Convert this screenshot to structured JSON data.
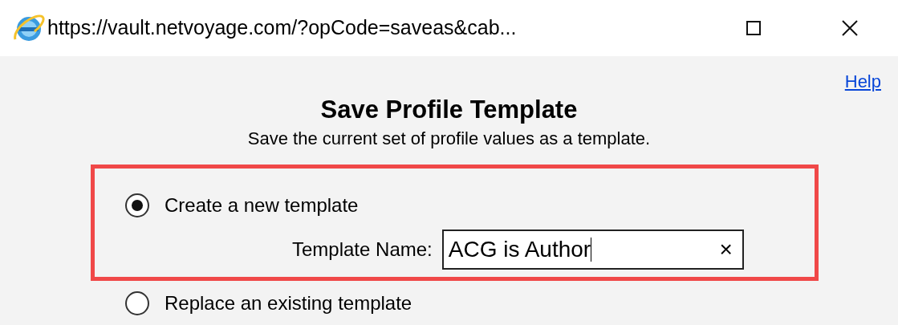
{
  "window": {
    "title": "https://vault.netvoyage.com/?opCode=saveas&cab..."
  },
  "help_link": "Help",
  "heading": "Save Profile Template",
  "subtitle": "Save the current set of profile values as a template.",
  "highlight": {
    "color": "#f04848"
  },
  "options": [
    {
      "label": "Create a new template",
      "selected": true
    },
    {
      "label": "Replace an existing template",
      "selected": false
    }
  ],
  "template_name": {
    "label": "Template Name:",
    "value": "ACG is Author",
    "clear": "×"
  }
}
